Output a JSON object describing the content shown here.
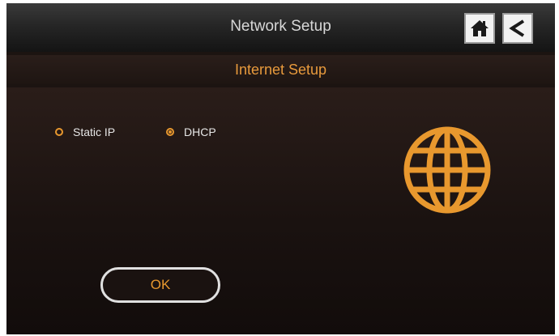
{
  "header": {
    "title": "Network Setup",
    "home_icon": "home-icon",
    "back_icon": "back-arrow-icon"
  },
  "subheader": {
    "title": "Internet Setup"
  },
  "options": {
    "static_ip": {
      "label": "Static IP",
      "selected": false
    },
    "dhcp": {
      "label": "DHCP",
      "selected": true
    }
  },
  "globe_icon": "globe-icon",
  "ok_label": "OK",
  "colors": {
    "accent": "#e8982e",
    "background": "#1c1411"
  }
}
